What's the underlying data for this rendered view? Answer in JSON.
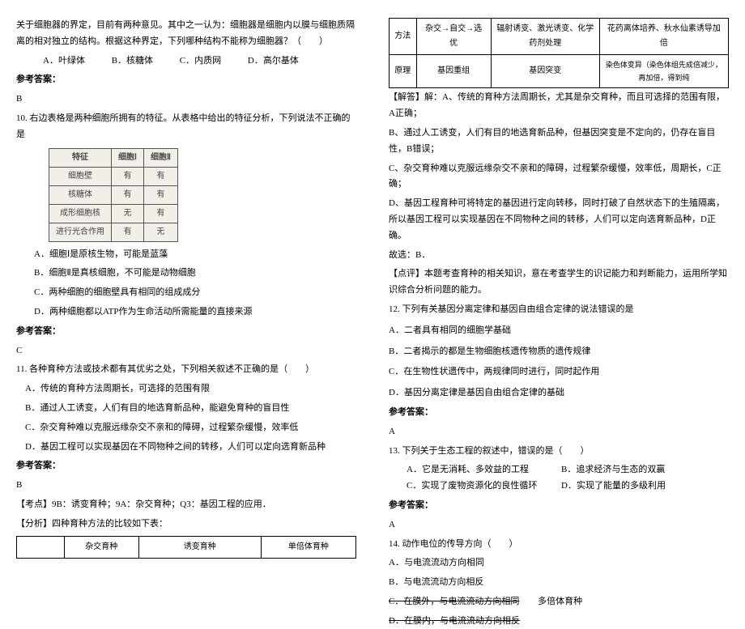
{
  "left": {
    "q_organelle_intro": "关于细胞器的界定，目前有两种意见。其中之一认为：细胞器是细胞内以膜与细胞质隔离的相对独立的结构。根据这种界定，下列哪种结构不能称为细胞器？（　　）",
    "q_organelle_opts": {
      "A": "A．叶绿体",
      "B": "B．核糖体",
      "C": "C．内质网",
      "D": "D．高尔基体"
    },
    "ans_label": "参考答案：",
    "ans_b": "B",
    "q10_stem": "10. 右边表格是两种细胞所拥有的特征。从表格中给出的特征分析，下列说法不正确的是",
    "tbl1": {
      "h": [
        "特征",
        "细胞Ⅰ",
        "细胞Ⅱ"
      ],
      "r1": [
        "细胞壁",
        "有",
        "有"
      ],
      "r2": [
        "核糖体",
        "有",
        "有"
      ],
      "r3": [
        "成形细胞核",
        "无",
        "有"
      ],
      "r4": [
        "进行光合作用",
        "有",
        "无"
      ]
    },
    "q10_opts": {
      "A": "A．细胞Ⅰ是原核生物，可能是蓝藻",
      "B": "B．细胞Ⅱ是真核细胞，不可能是动物细胞",
      "C": "C．两种细胞的细胞壁具有相同的组成成分",
      "D": "D．两种细胞都以ATP作为生命活动所需能量的直接来源"
    },
    "ans_c": "C",
    "q11_stem": "11. 各种育种方法或技术都有其优劣之处，下列相关叙述不正确的是（　　）",
    "q11_opts": {
      "A": "A．传统的育种方法周期长，可选择的范围有限",
      "B": "B．通过人工诱变，人们有目的地选育新品种，能避免育种的盲目性",
      "C": "C．杂交育种难以克服远缘杂交不亲和的障碍，过程繁杂缓慢，效率低",
      "D": "D．基因工程可以实现基因在不同物种之间的转移，人们可以定向选育新品种"
    },
    "kd_label": "【考点】9B：诱变育种；9A：杂交育种；Q3：基因工程的应用．",
    "fx_label": "【分析】四种育种方法的比较如下表：",
    "tbl2_h": [
      "",
      "杂交育种",
      "诱变育种",
      "单倍体育种"
    ]
  },
  "right": {
    "tbl3": {
      "r1": [
        "方法",
        "杂交→自交→选优",
        "辐射诱变、激光诱变、化学药剂处理",
        "花药离体培养、秋水仙素诱导加倍"
      ],
      "r2": [
        "原理",
        "基因重组",
        "基因突变",
        "染色体变异（染色体组先成倍减少，再加倍，得到纯"
      ]
    },
    "jd_label": "【解答】解：A、传统的育种方法周期长，尤其是杂交育种，而且可选择的范围有限，A正确；",
    "jd_b": "B、通过人工诱变，人们有目的地选育新品种，但基因突变是不定向的，仍存在盲目性，B错误；",
    "jd_c": "C、杂交育种难以克服远缘杂交不亲和的障碍，过程繁杂缓慢，效率低，周期长，C正确；",
    "jd_d": "D、基因工程育种可将特定的基因进行定向转移，同时打破了自然状态下的生殖隔离，所以基因工程可以实现基因在不同物种之间的转移，人们可以定向选育新品种，D正确。",
    "jd_sel": "故选：B．",
    "dp": "【点评】本题考查育种的相关知识，意在考查学生的识记能力和判断能力，运用所学知识综合分析问题的能力。",
    "q12_stem": "12. 下列有关基因分离定律和基因自由组合定律的说法错误的是",
    "q12_opts": {
      "A": "A．二者具有相同的细胞学基础",
      "B": "B．二者揭示的都是生物细胞核遗传物质的遗传规律",
      "C": "C．在生物性状遗传中，两规律同时进行，同时起作用",
      "D": "D．基因分离定律是基因自由组合定律的基础"
    },
    "ans_a": "A",
    "q13_stem": "13. 下列关于生态工程的叙述中，错误的是（　　）",
    "q13_opts": {
      "A": "A．它是无消耗、多效益的工程",
      "B": "B．追求经济与生态的双赢",
      "C": "C．实现了废物资源化的良性循环",
      "D": "D．实现了能量的多级利用"
    },
    "q14_stem": "14. 动作电位的传导方向（　　）",
    "q14_opts": {
      "A": "A．与电流流动方向相同",
      "B": "B．与电流流动方向相反",
      "C": "C．在膜外，与电流流动方向相同",
      "D": "D．在膜内，与电流流动方向相反",
      "CD_overlay": "多倍体育种"
    },
    "ans_label": "参考答案："
  }
}
